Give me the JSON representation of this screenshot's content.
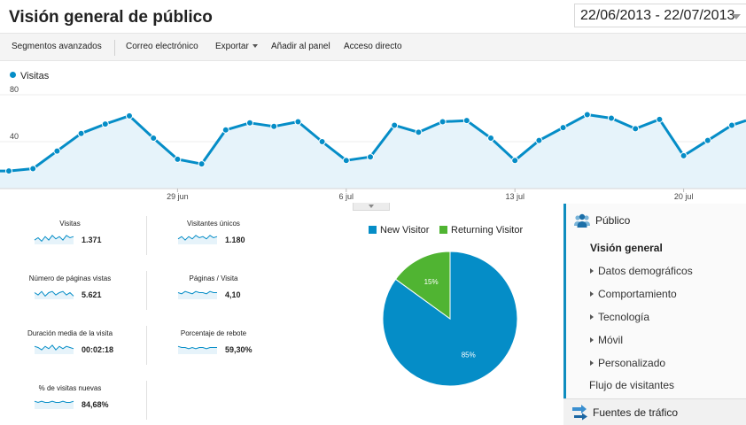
{
  "header": {
    "title": "Visión general de público",
    "date_range": "22/06/2013 - 22/07/2013"
  },
  "toolbar": {
    "segments": "Segmentos avanzados",
    "email": "Correo electrónico",
    "export": "Exportar",
    "add_panel": "Añadir al panel",
    "shortcut": "Acceso directo"
  },
  "legend": {
    "label": "Visitas"
  },
  "chart_data": [
    {
      "type": "area",
      "series": [
        {
          "name": "Visitas",
          "values": [
            15,
            17,
            32,
            47,
            55,
            62,
            43,
            25,
            21,
            50,
            56,
            53,
            57,
            40,
            24,
            27,
            54,
            48,
            57,
            58,
            43,
            24,
            41,
            52,
            63,
            60,
            51,
            59,
            28,
            41,
            54
          ]
        }
      ],
      "y_ticks": [
        "80",
        "40"
      ],
      "x_ticks": [
        "29 jun",
        "6 jul",
        "13 jul",
        "20 jul"
      ],
      "ylim": [
        0,
        90
      ],
      "color": "#058dc7",
      "fill": "#e6f3fa"
    },
    {
      "type": "pie",
      "series": [
        {
          "name": "New Visitor",
          "value": 85,
          "label": "85%",
          "color": "#058dc7"
        },
        {
          "name": "Returning Visitor",
          "value": 15,
          "label": "15%",
          "color": "#50b432"
        }
      ]
    }
  ],
  "metrics": [
    {
      "label": "Visitas",
      "value": "1.371"
    },
    {
      "label": "Visitantes únicos",
      "value": "1.180"
    },
    {
      "label": "Número de páginas vistas",
      "value": "5.621"
    },
    {
      "label": "Páginas / Visita",
      "value": "4,10"
    },
    {
      "label": "Duración media de la visita",
      "value": "00:02:18"
    },
    {
      "label": "Porcentaje de rebote",
      "value": "59,30%"
    },
    {
      "label": "% de visitas nuevas",
      "value": "84,68%"
    }
  ],
  "sidebar": {
    "section": "Público",
    "items": [
      {
        "label": "Visión general"
      },
      {
        "label": "Datos demográficos"
      },
      {
        "label": "Comportamiento"
      },
      {
        "label": "Tecnología"
      },
      {
        "label": "Móvil"
      },
      {
        "label": "Personalizado"
      },
      {
        "label": "Flujo de visitantes"
      }
    ],
    "footer": "Fuentes de tráfico"
  },
  "icons": {
    "audience": "audience-icon",
    "traffic": "traffic-sources-icon"
  },
  "colors": {
    "accent": "#058dc7",
    "returning": "#50b432",
    "sidebar_border": "#0f8dbf"
  }
}
